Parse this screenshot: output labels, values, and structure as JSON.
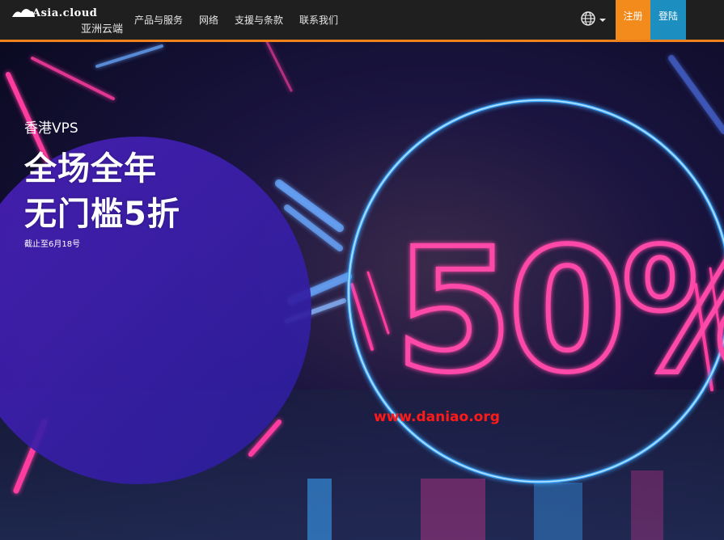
{
  "brand": {
    "logo_text": "Asia.cloud",
    "logo_subtitle": "亚洲云端"
  },
  "nav": {
    "items": [
      {
        "label": "产品与服务"
      },
      {
        "label": "网络"
      },
      {
        "label": "支援与条款"
      },
      {
        "label": "联系我们"
      }
    ],
    "language_icon": "globe-icon",
    "register_label": "注册",
    "login_label": "登陆"
  },
  "hero": {
    "kicker": "香港VPS",
    "headline_line1": "全场全年",
    "headline_line2": "无门槛5折",
    "deadline": "截止至6月18号",
    "graphic_text": "50%",
    "watermark": "www.daniao.org"
  },
  "colors": {
    "navbar_bg": "#1f1f1f",
    "accent_border": "#f0821e",
    "register_bg": "#f28a1c",
    "login_bg": "#1c8fc0",
    "hero_circle": "#3a2cc0",
    "neon_pink": "#ff3ca0",
    "neon_blue": "#3fa9ff",
    "watermark": "#ff1a1a"
  }
}
